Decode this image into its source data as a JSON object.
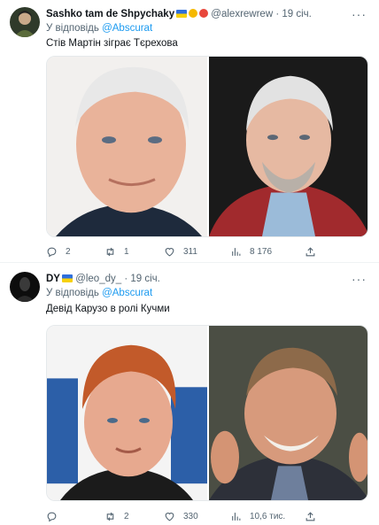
{
  "tweets": [
    {
      "display_name": "Sashko tam de Shpychaky",
      "handle": "@alexrewrew",
      "time": "· 19 січ.",
      "reply_prefix": "У відповідь",
      "reply_to": "@Abscurat",
      "text": "Стів Мартін зіграє Тєрехова",
      "stats": {
        "replies": "2",
        "retweets": "1",
        "likes": "311",
        "views": "8 176"
      }
    },
    {
      "display_name": "DY",
      "handle": "@leo_dy_",
      "time": "· 19 січ.",
      "reply_prefix": "У відповідь",
      "reply_to": "@Abscurat",
      "text": "Девід Карузо в ролі Кучми",
      "stats": {
        "replies": "",
        "retweets": "2",
        "likes": "330",
        "views": "10,6 тис."
      }
    }
  ],
  "icons": {
    "more": "more-horizontal-icon",
    "reply": "reply-icon",
    "retweet": "retweet-icon",
    "like": "heart-icon",
    "views": "views-chart-icon",
    "share": "share-icon"
  },
  "colors": {
    "link": "#1d9bf0",
    "muted": "#536471",
    "text": "#0f1419",
    "flag_blue": "#2f6fdc",
    "flag_yellow": "#f7d10a"
  }
}
